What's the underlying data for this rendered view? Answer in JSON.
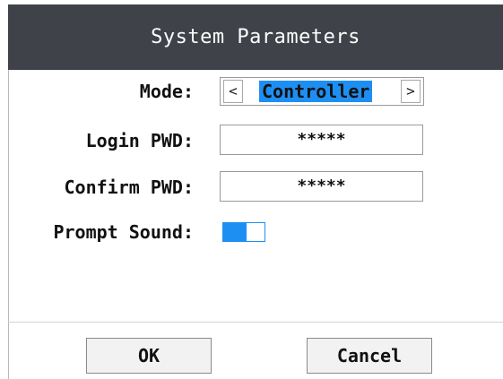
{
  "dialog": {
    "title": "System Parameters"
  },
  "form": {
    "mode": {
      "label": "Mode:",
      "value": "Controller",
      "prev_glyph": "<",
      "next_glyph": ">"
    },
    "login_pwd": {
      "label": "Login PWD:",
      "value": "*****"
    },
    "confirm_pwd": {
      "label": "Confirm PWD:",
      "value": "*****"
    },
    "prompt_sound": {
      "label": "Prompt Sound:",
      "enabled": true
    }
  },
  "buttons": {
    "ok_label": "OK",
    "cancel_label": "Cancel"
  },
  "colors": {
    "titlebar": "#3f4349",
    "accent": "#1e8ff2"
  }
}
